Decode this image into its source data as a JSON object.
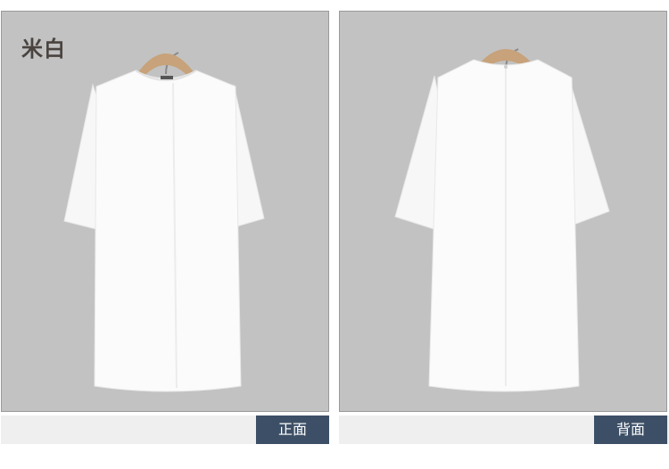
{
  "color_label": "米白",
  "captions": {
    "front": "正面",
    "back": "背面"
  },
  "colors": {
    "panel_background": "#c2c2c2",
    "garment": "#fbfbfb",
    "hanger": "#c7a27a",
    "caption_tag": "#3c4f66",
    "caption_bar": "#efefef"
  }
}
